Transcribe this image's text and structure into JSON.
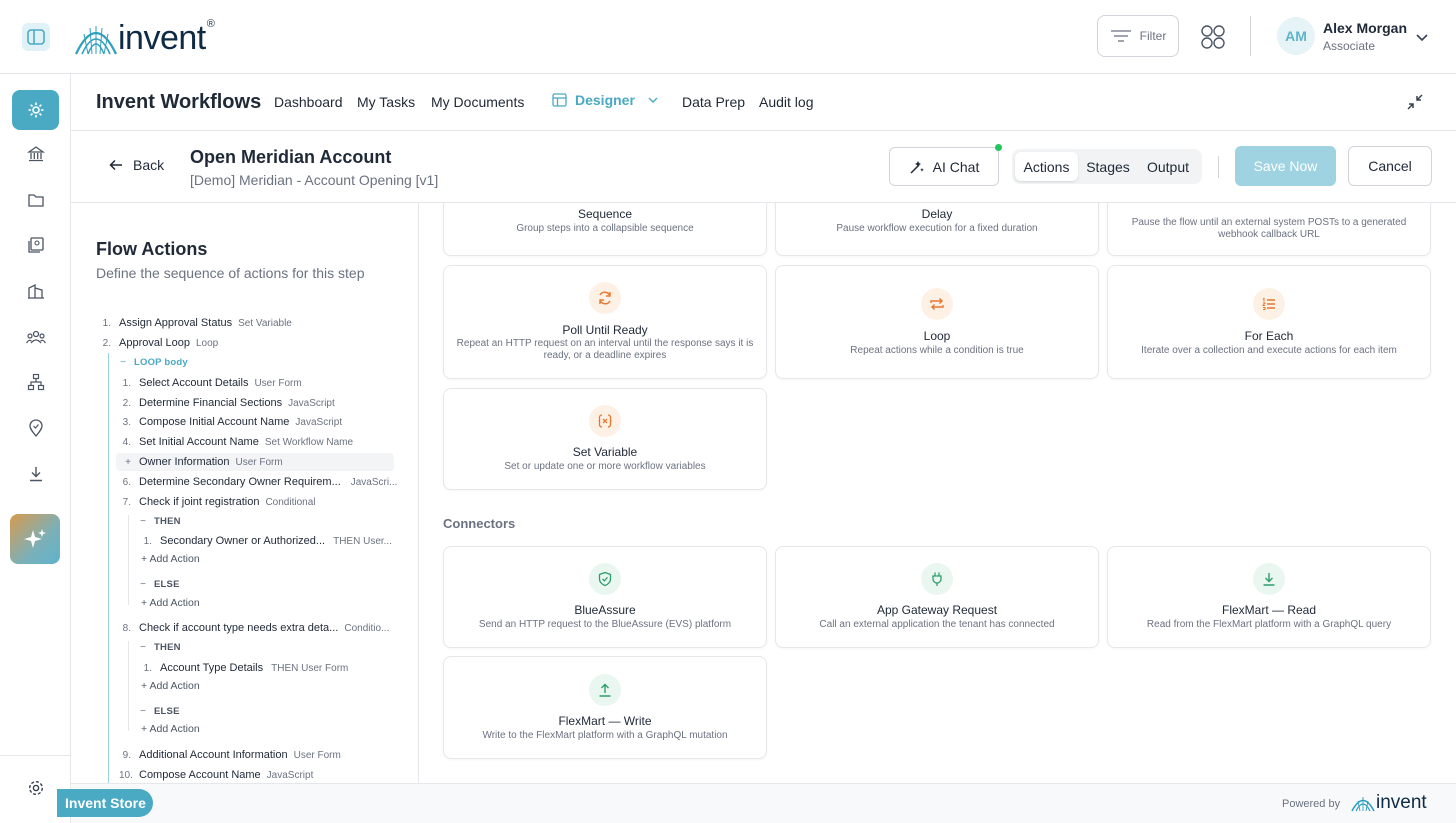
{
  "brand": {
    "logo_text": "invent",
    "registered": "®",
    "colors": {
      "accent": "#4aa9c3",
      "navy": "#0f2a44",
      "orange": "#e8772e",
      "green": "#2e9e6b"
    }
  },
  "topbar": {
    "filter_label": "Filter",
    "user": {
      "initials": "AM",
      "name": "Alex Morgan",
      "role": "Associate"
    }
  },
  "rail": {
    "icons": [
      "gear-icon",
      "bank-icon",
      "folder-icon",
      "book-icon",
      "buildings-icon",
      "users-icon",
      "sitemap-icon",
      "location-icon",
      "download-icon",
      "sparkle-icon",
      "settings-icon"
    ]
  },
  "nav": {
    "app_title": "Invent Workflows",
    "items": [
      "Dashboard",
      "My Tasks",
      "My Documents"
    ],
    "designer": "Designer",
    "items_after": [
      "Data Prep",
      "Audit log"
    ]
  },
  "header": {
    "back": "Back",
    "title": "Open Meridian Account",
    "subtitle": "[Demo] Meridian - Account Opening [v1]",
    "ai_chat": "AI Chat",
    "tabs": [
      "Actions",
      "Stages",
      "Output"
    ],
    "active_tab": "Actions",
    "save": "Save Now",
    "cancel": "Cancel"
  },
  "flow": {
    "title": "Flow Actions",
    "subtitle": "Define the sequence of actions for this step",
    "rows": [
      {
        "num": "1.",
        "name": "Assign Approval Status",
        "tag": "Set Variable"
      },
      {
        "num": "2.",
        "name": "Approval Loop",
        "tag": "Loop"
      },
      {
        "kw": "LOOP body",
        "sym": "−"
      },
      {
        "num": "1.",
        "name": "Select Account Details",
        "tag": "User Form"
      },
      {
        "num": "2.",
        "name": "Determine Financial Sections",
        "tag": "JavaScript"
      },
      {
        "num": "3.",
        "name": "Compose Initial Account Name",
        "tag": "JavaScript"
      },
      {
        "num": "4.",
        "name": "Set Initial Account Name",
        "tag": "Set Workflow Name"
      },
      {
        "num": "+",
        "name": "Owner Information",
        "tag": "User Form"
      },
      {
        "num": "6.",
        "name": "Determine Secondary Owner Requirem...",
        "tag": "JavaScri..."
      },
      {
        "num": "7.",
        "name": "Check if joint registration",
        "tag": "Conditional"
      },
      {
        "kw": "THEN",
        "sym": "−"
      },
      {
        "num": "1.",
        "name": "Secondary Owner or Authorized...",
        "tag": "THEN  User..."
      },
      {
        "add": "+ Add Action"
      },
      {
        "kw": "ELSE",
        "sym": "−"
      },
      {
        "add": "+ Add Action"
      },
      {
        "num": "8.",
        "name": "Check if account type needs extra deta...",
        "tag": "Conditio..."
      },
      {
        "kw": "THEN",
        "sym": "−"
      },
      {
        "num": "1.",
        "name": "Account Type Details",
        "tag": "THEN  User Form"
      },
      {
        "add": "+ Add Action"
      },
      {
        "kw": "ELSE",
        "sym": "−"
      },
      {
        "add": "+ Add Action"
      },
      {
        "num": "9.",
        "name": "Additional Account Information",
        "tag": "User Form"
      },
      {
        "num": "10.",
        "name": "Compose Account Name",
        "tag": "JavaScript"
      }
    ]
  },
  "cards": {
    "actions": [
      {
        "title": "Sequence",
        "desc": "Group steps into a collapsible sequence"
      },
      {
        "title": "Delay",
        "desc": "Pause workflow execution for a fixed duration"
      },
      {
        "title": "",
        "desc": "Pause the flow until an external system POSTs to a generated webhook callback URL"
      },
      {
        "title": "Poll Until Ready",
        "desc": "Repeat an HTTP request on an interval until the response says it is ready, or a deadline expires",
        "icon": "refresh-icon"
      },
      {
        "title": "Loop",
        "desc": "Repeat actions while a condition is true",
        "icon": "repeat-icon"
      },
      {
        "title": "For Each",
        "desc": "Iterate over a collection and execute actions for each item",
        "icon": "list-icon"
      },
      {
        "title": "Set Variable",
        "desc": "Set or update one or more workflow variables",
        "icon": "variable-icon"
      }
    ],
    "connectors_label": "Connectors",
    "connectors": [
      {
        "title": "BlueAssure",
        "desc": "Send an HTTP request to the BlueAssure (EVS) platform",
        "icon": "shield-check-icon"
      },
      {
        "title": "App Gateway Request",
        "desc": "Call an external application the tenant has connected",
        "icon": "plug-icon"
      },
      {
        "title": "FlexMart — Read",
        "desc": "Read from the FlexMart platform with a GraphQL query",
        "icon": "download-icon"
      },
      {
        "title": "FlexMart — Write",
        "desc": "Write to the FlexMart platform with a GraphQL mutation",
        "icon": "upload-icon"
      }
    ]
  },
  "footer": {
    "store": "Invent Store",
    "powered": "Powered by",
    "logo_text": "invent"
  }
}
